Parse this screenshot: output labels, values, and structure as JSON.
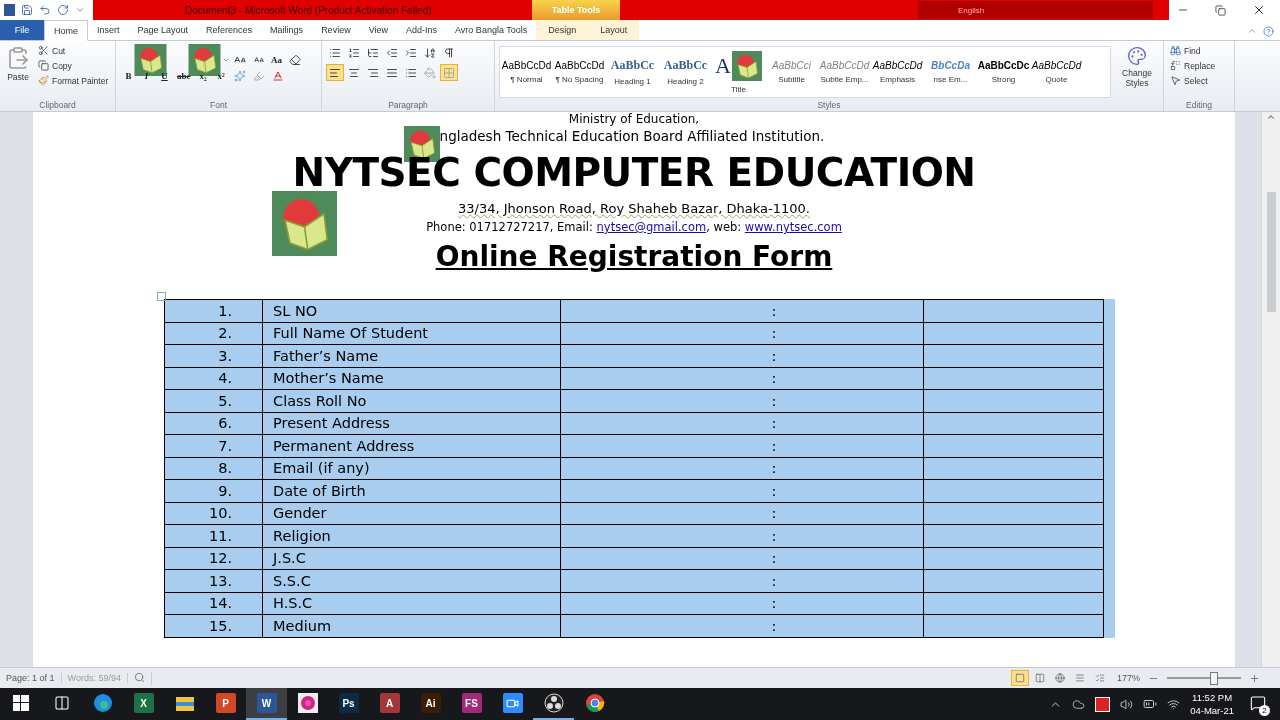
{
  "window": {
    "title": "Document3  -  Microsoft Word (Product Activation Failed)",
    "contextual_tab": "Table Tools",
    "language": "English"
  },
  "tabs": [
    {
      "label": "File",
      "kind": "file",
      "selected": false
    },
    {
      "label": "Home",
      "kind": "tab",
      "selected": true
    },
    {
      "label": "Insert",
      "kind": "tab",
      "selected": false
    },
    {
      "label": "Page Layout",
      "kind": "tab",
      "selected": false
    },
    {
      "label": "References",
      "kind": "tab",
      "selected": false
    },
    {
      "label": "Mailings",
      "kind": "tab",
      "selected": false
    },
    {
      "label": "Review",
      "kind": "tab",
      "selected": false
    },
    {
      "label": "View",
      "kind": "tab",
      "selected": false
    },
    {
      "label": "Add-Ins",
      "kind": "tab",
      "selected": false
    },
    {
      "label": "Avro Bangla Tools",
      "kind": "tab",
      "selected": false
    },
    {
      "label": "Design",
      "kind": "context",
      "selected": false
    },
    {
      "label": "Layout",
      "kind": "context",
      "selected": false
    }
  ],
  "clipboard": {
    "paste": "Paste",
    "cut": "Cut",
    "copy": "Copy",
    "format_painter": "Format Painter",
    "label": "Clipboard"
  },
  "font": {
    "label": "Font",
    "change_case": "Aa",
    "styles": [
      "B",
      "I",
      "U",
      "abc",
      "x₂",
      "x²"
    ]
  },
  "paragraph": {
    "label": "Paragraph",
    "alignments": [
      {
        "kind": "left",
        "selected": true
      },
      {
        "kind": "center",
        "selected": false
      },
      {
        "kind": "right",
        "selected": false
      },
      {
        "kind": "justify",
        "selected": false
      }
    ],
    "borders_on": true
  },
  "styles": {
    "label": "Styles",
    "items": [
      {
        "preview": "AaBbCcDd",
        "name": "¶ Normal",
        "kind": "normal"
      },
      {
        "preview": "AaBbCcDd",
        "name": "¶ No Spacing",
        "kind": "normal"
      },
      {
        "preview": "AaBbCc",
        "name": "Heading 1",
        "kind": "heading"
      },
      {
        "preview": "AaBbCc",
        "name": "Heading 2",
        "kind": "heading"
      },
      {
        "preview": "A",
        "name": "Title",
        "kind": "title"
      },
      {
        "preview": "AaBbCci",
        "name": "Subtitle",
        "kind": "subtle"
      },
      {
        "preview": "AaBbCcDd",
        "name": "Subtle Emp...",
        "kind": "subtle"
      },
      {
        "preview": "AaBbCcDd",
        "name": "Emphasis",
        "kind": "emphasis"
      },
      {
        "preview": "BbCcDa",
        "name": "nse Em...",
        "kind": "intense"
      },
      {
        "preview": "AaBbCcDc",
        "name": "Strong",
        "kind": "strong"
      },
      {
        "preview": "AaBbCcDd",
        "name": "Quote",
        "kind": "emphasis"
      }
    ],
    "change_styles": "Change Styles"
  },
  "editing": {
    "label": "Editing",
    "find": "Find",
    "replace": "Replace",
    "select": "Select"
  },
  "document": {
    "ministry": "Ministry of Education,",
    "institution": "ngladesh Technical Education Board Affiliated Institution.",
    "name": "NYTSEC COMPUTER EDUCATION",
    "address": "33/34, Jhonson Road, Roy Shaheb Bazar, Dhaka-1100.",
    "contact_prefix": "Phone: 01712727217, Email: ",
    "email": "nytsec@gmail.com",
    "contact_middle": ", web: ",
    "web": "www.nytsec.com",
    "form_title": "Online Registration Form"
  },
  "table": {
    "selected": true,
    "rows": [
      {
        "number": "1.",
        "label": "SL NO",
        "separator": ":"
      },
      {
        "number": "2.",
        "label": "Full Name Of Student",
        "separator": ":"
      },
      {
        "number": "3.",
        "label": "Father’s Name",
        "separator": ":"
      },
      {
        "number": "4.",
        "label": "Mother’s Name",
        "separator": ":"
      },
      {
        "number": "5.",
        "label": "Class Roll No",
        "separator": ":"
      },
      {
        "number": "6.",
        "label": "Present Address",
        "separator": ":"
      },
      {
        "number": "7.",
        "label": "Permanent Address",
        "separator": ":"
      },
      {
        "number": "8.",
        "label": "Email (if any)",
        "separator": ":"
      },
      {
        "number": "9.",
        "label": "Date of Birth",
        "separator": ":"
      },
      {
        "number": "10.",
        "label": "Gender",
        "separator": ":"
      },
      {
        "number": "11.",
        "label": "Religion",
        "separator": ":"
      },
      {
        "number": "12.",
        "label": "J.S.C",
        "separator": ":"
      },
      {
        "number": "13.",
        "label": "S.S.C",
        "separator": ":"
      },
      {
        "number": "14.",
        "label": "H.S.C",
        "separator": ":"
      },
      {
        "number": "15.",
        "label": "Medium",
        "separator": ":"
      }
    ]
  },
  "status_bar": {
    "page": "Page: 1 of 1",
    "words": "Words: 59/94",
    "views": [
      {
        "kind": "print",
        "selected": true
      },
      {
        "kind": "read",
        "selected": false
      },
      {
        "kind": "web",
        "selected": false
      },
      {
        "kind": "outline",
        "selected": false
      },
      {
        "kind": "draft",
        "selected": false
      }
    ],
    "zoom": "177%",
    "zoom_slider": {
      "level": 0.63
    }
  },
  "taskbar": {
    "items": [
      {
        "kind": "start",
        "active": false,
        "running": false
      },
      {
        "kind": "task_view",
        "active": false,
        "running": false
      },
      {
        "kind": "edge",
        "active": false,
        "running": false
      },
      {
        "kind": "tile",
        "label": "X",
        "color": "#1e7145",
        "active": false,
        "running": false
      },
      {
        "kind": "folder",
        "active": false,
        "running": false
      },
      {
        "kind": "tile",
        "label": "P",
        "color": "#d24726",
        "active": false,
        "running": false
      },
      {
        "kind": "tile",
        "label": "W",
        "color": "#2b579a",
        "active": true,
        "running": true
      },
      {
        "kind": "flower",
        "active": false,
        "running": false
      },
      {
        "kind": "tile",
        "label": "Ps",
        "color": "#0b2a44",
        "active": false,
        "running": false
      },
      {
        "kind": "tile",
        "label": "A",
        "color": "#a4373a",
        "active": false,
        "running": false
      },
      {
        "kind": "tile",
        "label": "Ai",
        "color": "#3a1d05",
        "active": false,
        "running": false
      },
      {
        "kind": "tile",
        "label": "FS",
        "color": "#a3287a",
        "active": false,
        "running": false
      },
      {
        "kind": "zoom",
        "active": false,
        "running": false
      },
      {
        "kind": "obs",
        "active": false,
        "running": true
      },
      {
        "kind": "chrome",
        "active": false,
        "running": false
      }
    ],
    "time": "11:52 PM",
    "date": "04-Mar-21",
    "notifications": "2"
  }
}
